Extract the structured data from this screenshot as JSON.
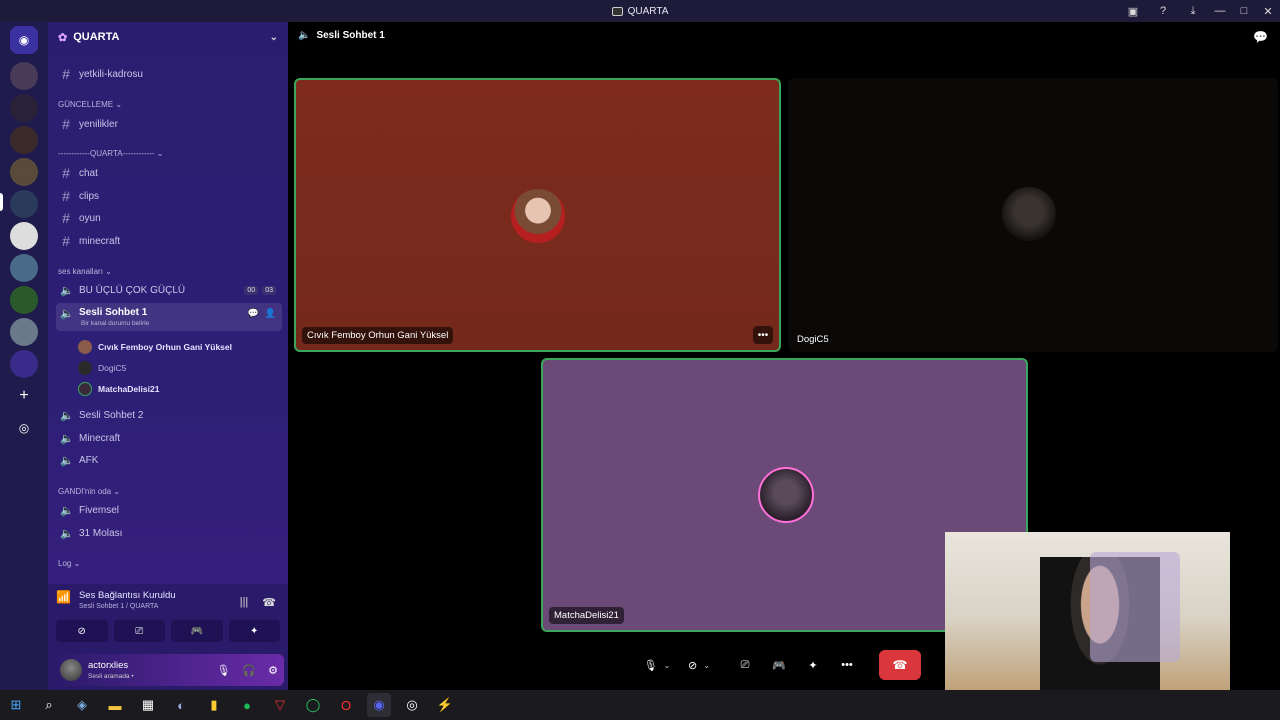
{
  "window": {
    "title": "QUARTA"
  },
  "guild": {
    "name": "QUARTA"
  },
  "channels": {
    "top_partial": "yetkili-kadrosu",
    "cat_guncelleme": "GÜNCELLEME",
    "yenilikler": "yenilikler",
    "cat_quarta": "------------QUARTA------------",
    "text": [
      "chat",
      "clips",
      "oyun",
      "minecraft"
    ],
    "cat_ses": "ses kanalları",
    "bu_uclu": "BU ÜÇLÜ ÇOK GÜÇLÜ",
    "bu_uclu_badges": [
      "00",
      "03"
    ],
    "sesli1": "Sesli Sohbet 1",
    "sesli1_sub": "Bir kanal durumu belirle",
    "members": [
      "Cıvık Femboy Orhun Gani Yüksel",
      "DogiC5",
      "MatchaDelisi21"
    ],
    "voice2": [
      "Sesli Sohbet 2",
      "Minecraft",
      "AFK"
    ],
    "cat_gandi": "GANDI'nin oda",
    "voice3": [
      "Fivemsel",
      "31 Molası"
    ],
    "cat_log": "Log"
  },
  "voice_status": {
    "title": "Ses Bağlantısı Kuruldu",
    "subtitle": "Sesli Sohbet 1 / QUARTA"
  },
  "user": {
    "name": "actorxlies",
    "status": "Sesli aramada •"
  },
  "call": {
    "channel": "Sesli Sohbet 1",
    "tiles": [
      {
        "name": "Cıvık Femboy Orhun Gani Yüksel",
        "color": "#7a2a1c",
        "speaking": true
      },
      {
        "name": "DogiC5",
        "color": "#0a0908",
        "speaking": false
      },
      {
        "name": "MatchaDelisi21",
        "color": "#6c4a78",
        "speaking": true
      }
    ]
  },
  "colors": {
    "speaking": "#3ba55c",
    "end_call": "#da373c",
    "sidebar": "#2b1d6e"
  }
}
